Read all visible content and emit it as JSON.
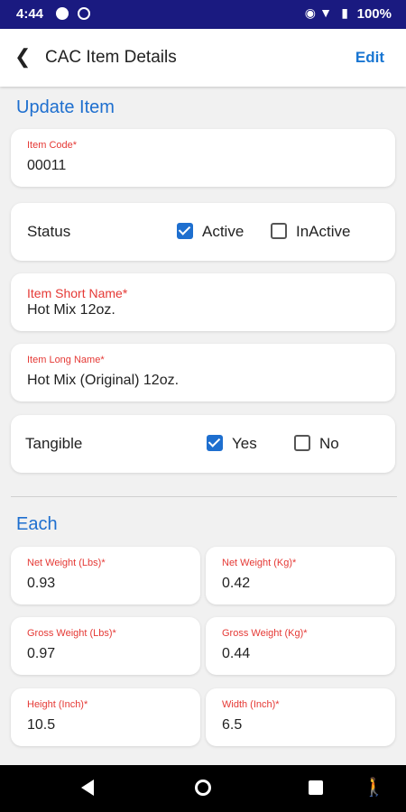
{
  "status_bar": {
    "time": "4:44",
    "battery": "100%"
  },
  "app_bar": {
    "title": "CAC Item Details",
    "edit_label": "Edit"
  },
  "update_section": {
    "title": "Update Item",
    "item_code": {
      "label": "Item Code*",
      "value": "00011"
    },
    "status": {
      "label": "Status",
      "options": [
        {
          "label": "Active",
          "checked": true
        },
        {
          "label": "InActive",
          "checked": false
        }
      ]
    },
    "short_name": {
      "label": "Item Short Name*",
      "value": "Hot Mix 12oz."
    },
    "long_name": {
      "label": "Item Long Name*",
      "value": "Hot Mix (Original) 12oz."
    },
    "tangible": {
      "label": "Tangible",
      "options": [
        {
          "label": "Yes",
          "checked": true
        },
        {
          "label": "No",
          "checked": false
        }
      ]
    }
  },
  "each_section": {
    "title": "Each",
    "fields": [
      {
        "label": "Net Weight (Lbs)*",
        "value": "0.93"
      },
      {
        "label": "Net Weight (Kg)*",
        "value": "0.42"
      },
      {
        "label": "Gross Weight (Lbs)*",
        "value": "0.97"
      },
      {
        "label": "Gross Weight (Kg)*",
        "value": "0.44"
      },
      {
        "label": "Height (Inch)*",
        "value": "10.5"
      },
      {
        "label": "Width (Inch)*",
        "value": "6.5"
      }
    ]
  },
  "colors": {
    "accent": "#1e6fcf",
    "label_red": "#e53935",
    "status_bar": "#1a1a80"
  }
}
